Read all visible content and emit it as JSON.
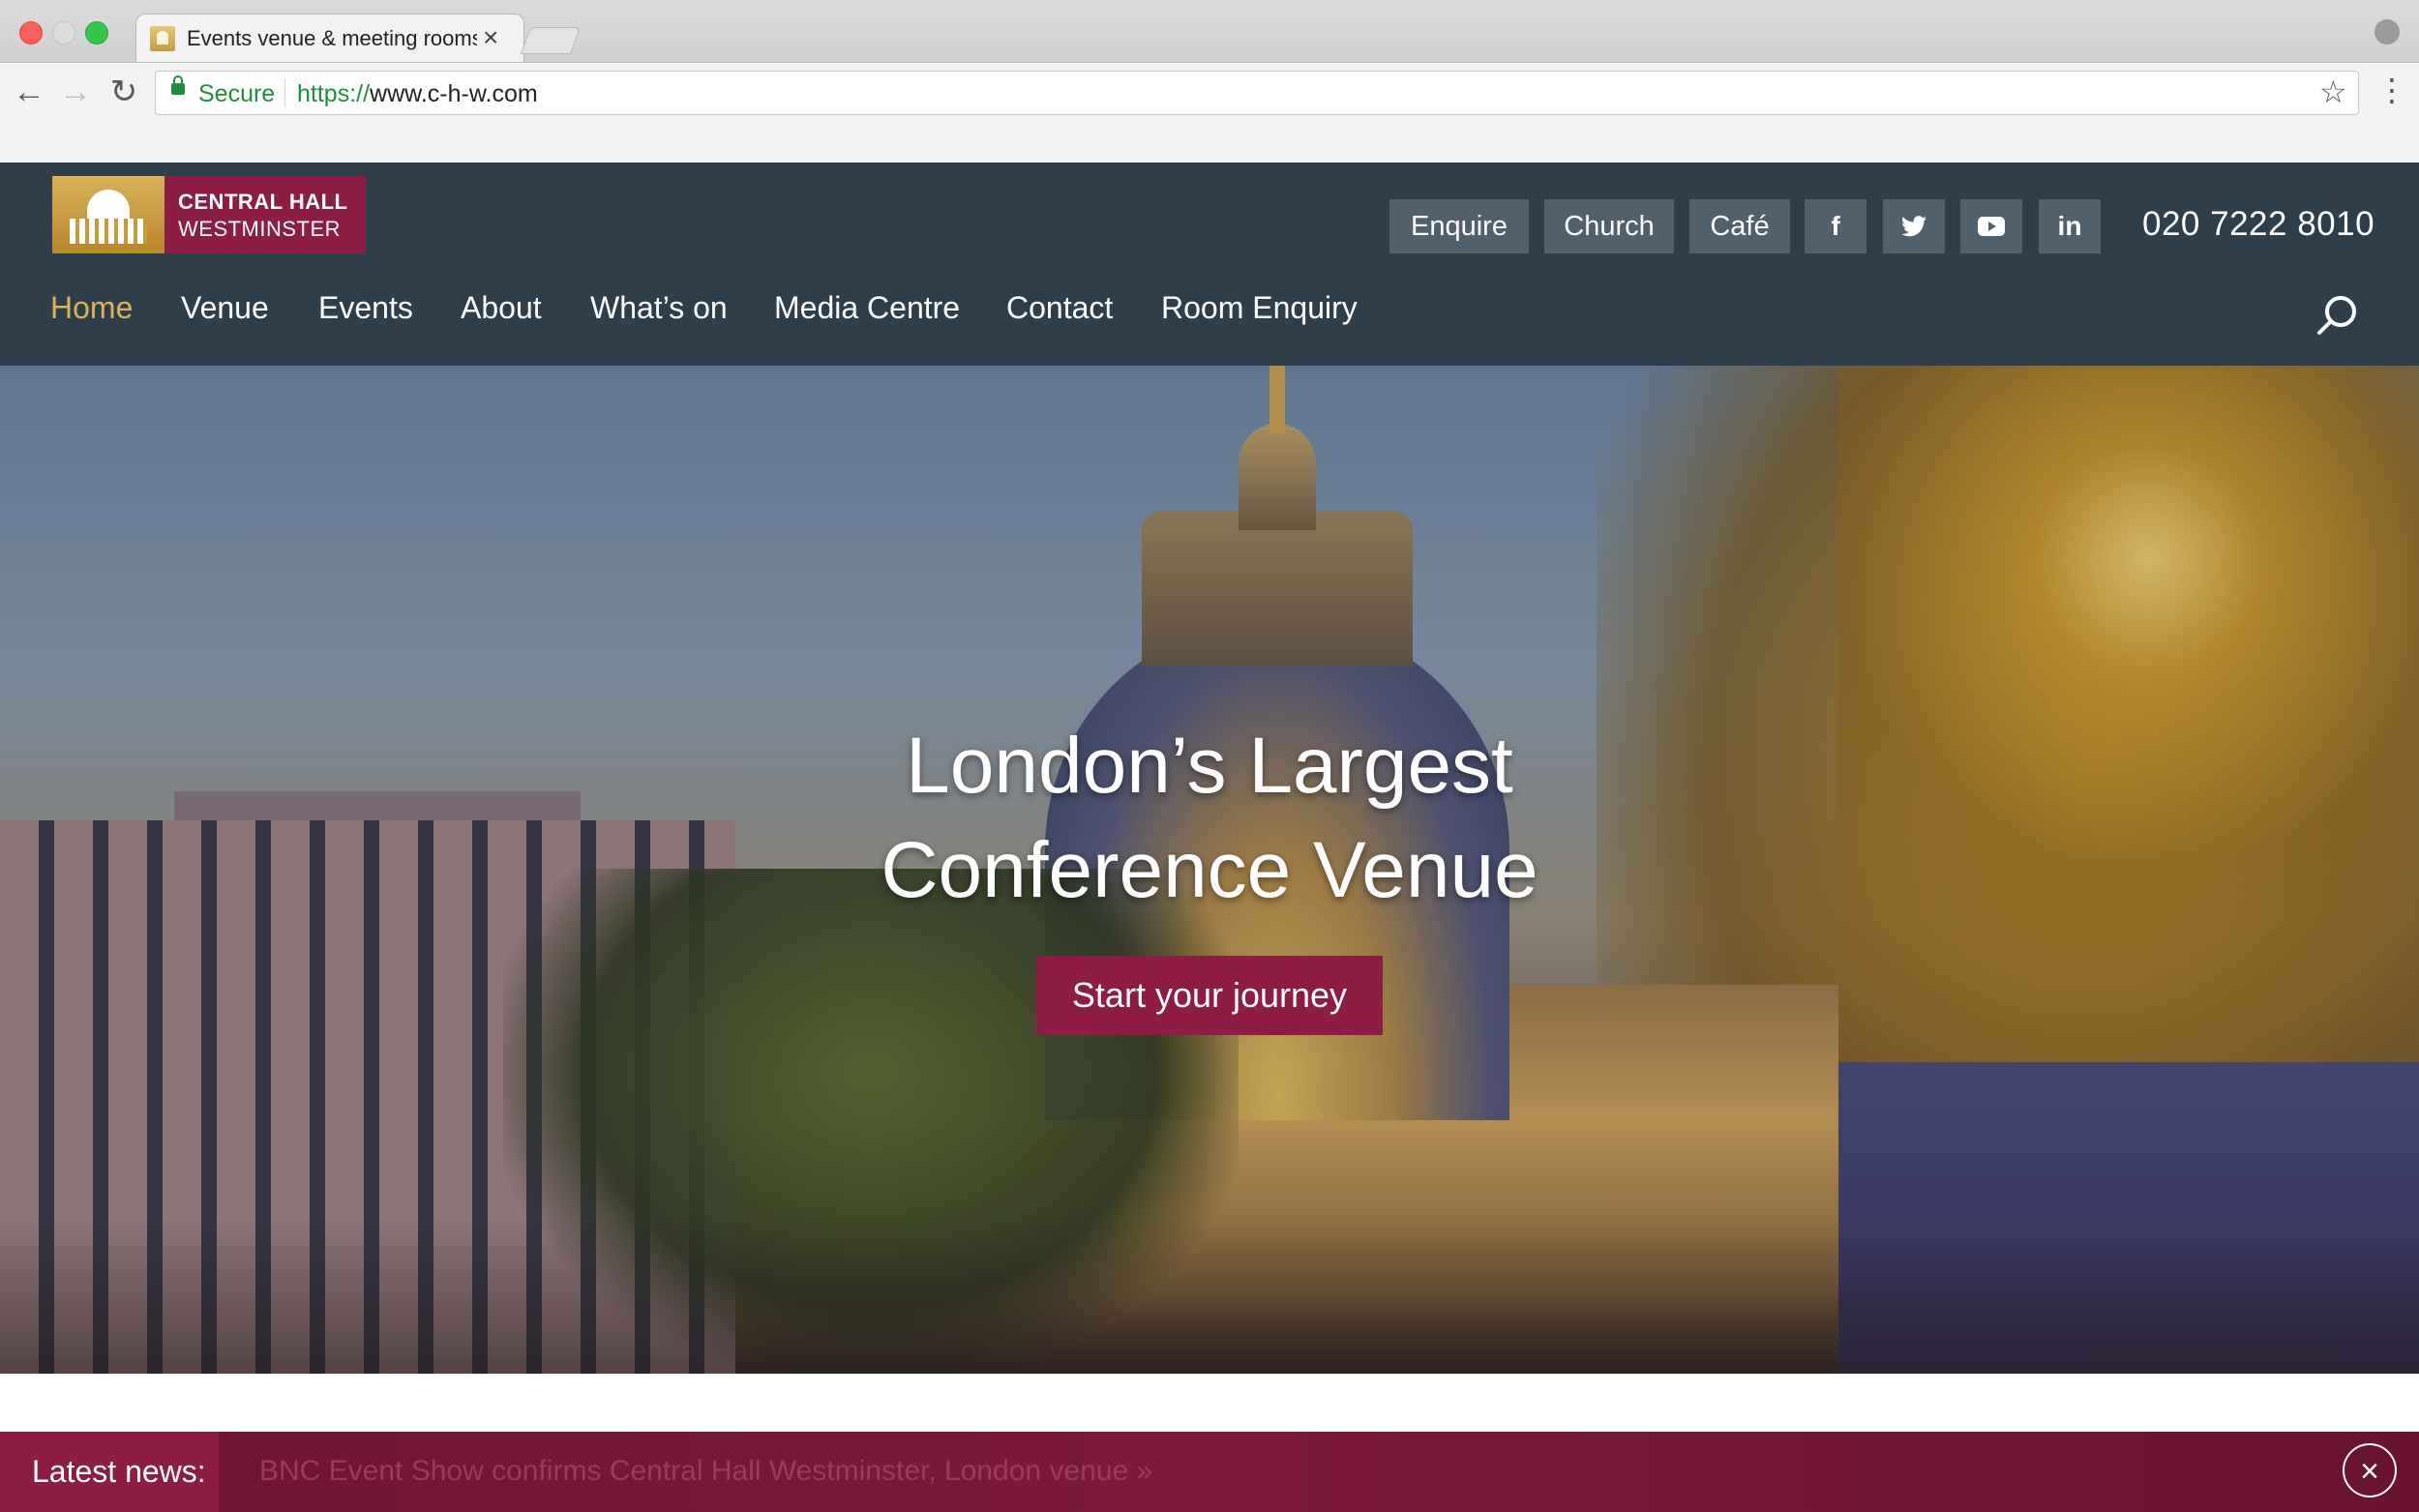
{
  "browser": {
    "tab_title": "Events venue & meeting rooms",
    "tab_close": "×",
    "secure_label": "Secure",
    "url_scheme": "https://",
    "url_host": "www.c-h-w.com",
    "back_icon": "←",
    "forward_icon": "→",
    "reload_icon": "↻",
    "star_icon": "☆",
    "menu_icon": "⋮"
  },
  "header": {
    "logo_line1": "CENTRAL HALL",
    "logo_line2": "WESTMINSTER",
    "utility": {
      "enquire": "Enquire",
      "church": "Church",
      "cafe": "Café"
    },
    "social": {
      "facebook": "f",
      "twitter": "🐦",
      "youtube": "▶",
      "linkedin": "in"
    },
    "phone": "020 7222 8010"
  },
  "nav": {
    "items": [
      {
        "label": "Home",
        "active": true
      },
      {
        "label": "Venue"
      },
      {
        "label": "Events"
      },
      {
        "label": "About"
      },
      {
        "label": "What’s on"
      },
      {
        "label": "Media Centre"
      },
      {
        "label": "Contact"
      },
      {
        "label": "Room Enquiry"
      }
    ]
  },
  "hero": {
    "title_line1": "London’s Largest",
    "title_line2": "Conference Venue",
    "cta_label": "Start your journey"
  },
  "news": {
    "label": "Latest news:",
    "headline": "BNC Event Show confirms Central Hall Westminster, London venue  »",
    "close_icon": "×"
  },
  "colors": {
    "header_bg": "#2e3e4b",
    "brand_maroon": "#8d1d45",
    "brand_gold": "#d9b25a",
    "utility_btn": "#50606c"
  }
}
